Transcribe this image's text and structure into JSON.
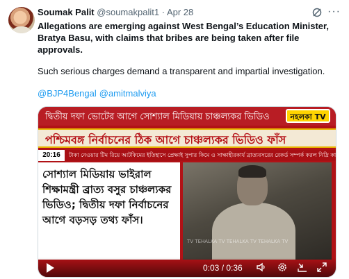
{
  "tweet": {
    "author_name": "Soumak Palit",
    "handle": "@soumakpalit1",
    "separator": "·",
    "date": "Apr 28",
    "text_bold": "Allegations are emerging against West Bengal’s Education Minister, Bratya Basu, with claims that bribes are being taken after file approvals.",
    "text_normal": "Such serious charges demand a transparent and impartial investigation.",
    "mentions": [
      "@BJP4Bengal",
      "@amitmalviya"
    ],
    "more_label": "···"
  },
  "media": {
    "top_banner": "দ্বিতীয় দফা ভোটের আগে সোশ্যাল মিডিয়ায় চাঞ্চল্যকর ভিডিও",
    "logo_text": "নহলকা TV",
    "headline": "পশ্চিমবঙ্গ নির্বাচনের ঠিক আগে চাঞ্চল্যকর ভিডিও ফাঁস",
    "ticker_time": "20:16",
    "ticker_text": "টাকা নেওয়ার টিম রিয়ে আটকিমের ইতিহাসে প্রেক্ষাই সুপার কিমে ও সাক্ষাহীরকার্য ব্রাত্যবসরের রেকর্ড সম্পর্ক করল নিদ্রি কাংগ্রেসিস",
    "panel_text": "সোশ্যাল মিডিয়ায় ভাইরাল শিক্ষামন্ত্রী ব্রাত্য বসুর চাঞ্চল্যকর ভিডিও; দ্বিতীয় দফা নির্বাচনের আগে বড়সড় তথ্য ফাঁস।",
    "watermark": "TV TEHALKA TV  TEHALKA TV  TEHALKA TV",
    "time_display": "0:03 / 0:36"
  },
  "icons": [
    "grok-icon",
    "more-icon",
    "play-icon",
    "volume-icon",
    "settings-icon",
    "minimize-icon",
    "fullscreen-icon"
  ],
  "colors": {
    "link": "#1d9bf0",
    "banner_red": "#b81d24",
    "logo_yellow": "#ffd400"
  }
}
